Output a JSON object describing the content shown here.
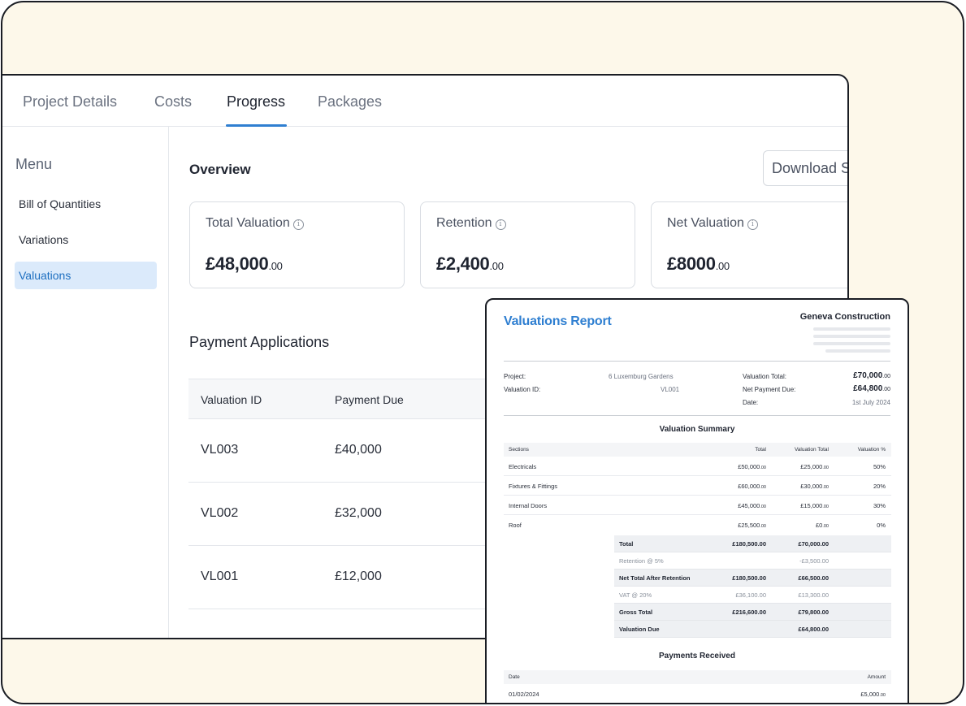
{
  "tabs": [
    {
      "label": "Project Details"
    },
    {
      "label": "Costs"
    },
    {
      "label": "Progress"
    },
    {
      "label": "Packages"
    }
  ],
  "sidebar": {
    "title": "Menu",
    "items": [
      {
        "label": "Bill of Quantities"
      },
      {
        "label": "Variations"
      },
      {
        "label": "Valuations"
      }
    ]
  },
  "overview": {
    "title": "Overview",
    "download_label": "Download S",
    "cards": [
      {
        "label": "Total Valuation",
        "value": "£48,000",
        "decimals": ".00"
      },
      {
        "label": "Retention",
        "value": "£2,400",
        "decimals": ".00"
      },
      {
        "label": "Net Valuation",
        "value": "£8000",
        "decimals": ".00"
      }
    ],
    "info_glyph": "i"
  },
  "payments": {
    "title": "Payment Applications",
    "headers": [
      "Valuation ID",
      "Payment Due"
    ],
    "rows": [
      {
        "id": "VL003",
        "due": "£40,000"
      },
      {
        "id": "VL002",
        "due": "£32,000"
      },
      {
        "id": "VL001",
        "due": "£12,000"
      }
    ]
  },
  "report": {
    "title": "Valuations Report",
    "company": "Geneva Construction",
    "meta": {
      "project_label": "Project:",
      "project_value": "6 Luxemburg Gardens",
      "valuation_id_label": "Valuation ID:",
      "valuation_id_value": "VL001",
      "valuation_total_label": "Valuation Total:",
      "valuation_total_value": "£70,000",
      "valuation_total_dec": ".00",
      "net_payment_label": "Net Payment Due:",
      "net_payment_value": "£64,800",
      "net_payment_dec": ".00",
      "date_label": "Date:",
      "date_value": "1st July 2024"
    },
    "summary_title": "Valuation Summary",
    "summary_headers": [
      "Sections",
      "Total",
      "Valuation Total",
      "Valuation %"
    ],
    "summary_rows": [
      {
        "section": "Electricals",
        "total": "£50,000",
        "total_dec": ".00",
        "val_total": "£25,000",
        "val_dec": ".00",
        "pct": "50%"
      },
      {
        "section": "Fixtures & Fittings",
        "total": "£60,000",
        "total_dec": ".00",
        "val_total": "£30,000",
        "val_dec": ".00",
        "pct": "20%"
      },
      {
        "section": "Internal Doors",
        "total": "£45,000",
        "total_dec": ".00",
        "val_total": "£15,000",
        "val_dec": ".00",
        "pct": "30%"
      },
      {
        "section": "Roof",
        "total": "£25,500",
        "total_dec": ".00",
        "val_total": "£0",
        "val_dec": ".00",
        "pct": "0%"
      }
    ],
    "totals": [
      {
        "label": "Total",
        "total": "£180,500.00",
        "val": "£70,000.00",
        "style": "dark"
      },
      {
        "label": "Retention @ 5%",
        "total": "",
        "val": "-£3,500.00",
        "style": "light"
      },
      {
        "label": "Net Total After Retention",
        "total": "£180,500.00",
        "val": "£66,500.00",
        "style": "dark"
      },
      {
        "label": "VAT @ 20%",
        "total": "£36,100.00",
        "val": "£13,300.00",
        "style": "light"
      },
      {
        "label": "Gross Total",
        "total": "£216,600.00",
        "val": "£79,800.00",
        "style": "dark"
      },
      {
        "label": "Valuation Due",
        "total": "",
        "val": "£64,800.00",
        "style": "dark"
      }
    ],
    "payments_title": "Payments Received",
    "payments_headers": [
      "Date",
      "Amount"
    ],
    "payments_rows": [
      {
        "date": "01/02/2024",
        "amount": "£5,000",
        "amount_dec": ".00"
      }
    ]
  }
}
